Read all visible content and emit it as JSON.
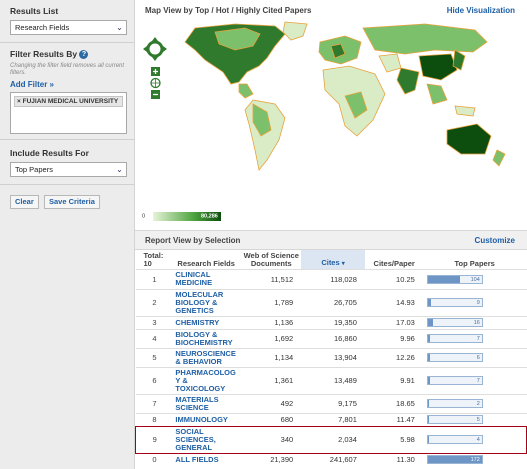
{
  "sidebar": {
    "results_list": {
      "title": "Results List",
      "selected": "Research Fields"
    },
    "filter": {
      "title": "Filter Results By",
      "hint": "Changing the filter field removes all current filters.",
      "add_label": "Add Filter »",
      "chips": [
        "FUJIAN MEDICAL UNIVERSITY"
      ]
    },
    "include": {
      "title": "Include Results For",
      "selected": "Top Papers"
    },
    "buttons": {
      "clear": "Clear",
      "save": "Save Criteria"
    }
  },
  "map": {
    "title": "Map View by Top / Hot / Highly Cited Papers",
    "hide_label": "Hide Visualization",
    "legend_min": "0",
    "legend_max": "80,286",
    "colors": {
      "low": "#d9ecc6",
      "mid": "#7cc06b",
      "high": "#2f7a2d",
      "top": "#0d4d0d",
      "border": "#e8a23c"
    }
  },
  "report": {
    "title": "Report View by Selection",
    "customize_label": "Customize",
    "headers": {
      "total_label": "Total:",
      "total_value": "10",
      "field": "Research Fields",
      "docs": "Web of Science Documents",
      "cites": "Cites",
      "per_paper": "Cites/Paper",
      "top": "Top Papers"
    },
    "rows": [
      {
        "rank": "1",
        "field": "CLINICAL MEDICINE",
        "docs": "11,512",
        "cites": "118,028",
        "per_paper": "10.25",
        "top": "104"
      },
      {
        "rank": "2",
        "field": "MOLECULAR BIOLOGY & GENETICS",
        "docs": "1,789",
        "cites": "26,705",
        "per_paper": "14.93",
        "top": "9"
      },
      {
        "rank": "3",
        "field": "CHEMISTRY",
        "docs": "1,136",
        "cites": "19,350",
        "per_paper": "17.03",
        "top": "16"
      },
      {
        "rank": "4",
        "field": "BIOLOGY & BIOCHEMISTRY",
        "docs": "1,692",
        "cites": "16,860",
        "per_paper": "9.96",
        "top": "7"
      },
      {
        "rank": "5",
        "field": "NEUROSCIENCE & BEHAVIOR",
        "docs": "1,134",
        "cites": "13,904",
        "per_paper": "12.26",
        "top": "6"
      },
      {
        "rank": "6",
        "field": "PHARMACOLOG Y & TOXICOLOGY",
        "docs": "1,361",
        "cites": "13,489",
        "per_paper": "9.91",
        "top": "7"
      },
      {
        "rank": "7",
        "field": "MATERIALS SCIENCE",
        "docs": "492",
        "cites": "9,175",
        "per_paper": "18.65",
        "top": "2"
      },
      {
        "rank": "8",
        "field": "IMMUNOLOGY",
        "docs": "680",
        "cites": "7,801",
        "per_paper": "11.47",
        "top": "5"
      },
      {
        "rank": "9",
        "field": "SOCIAL SCIENCES, GENERAL",
        "docs": "340",
        "cites": "2,034",
        "per_paper": "5.98",
        "top": "4",
        "highlight": true
      },
      {
        "rank": "0",
        "field": "ALL FIELDS",
        "docs": "21,390",
        "cites": "241,607",
        "per_paper": "11.30",
        "top": "172"
      }
    ]
  }
}
